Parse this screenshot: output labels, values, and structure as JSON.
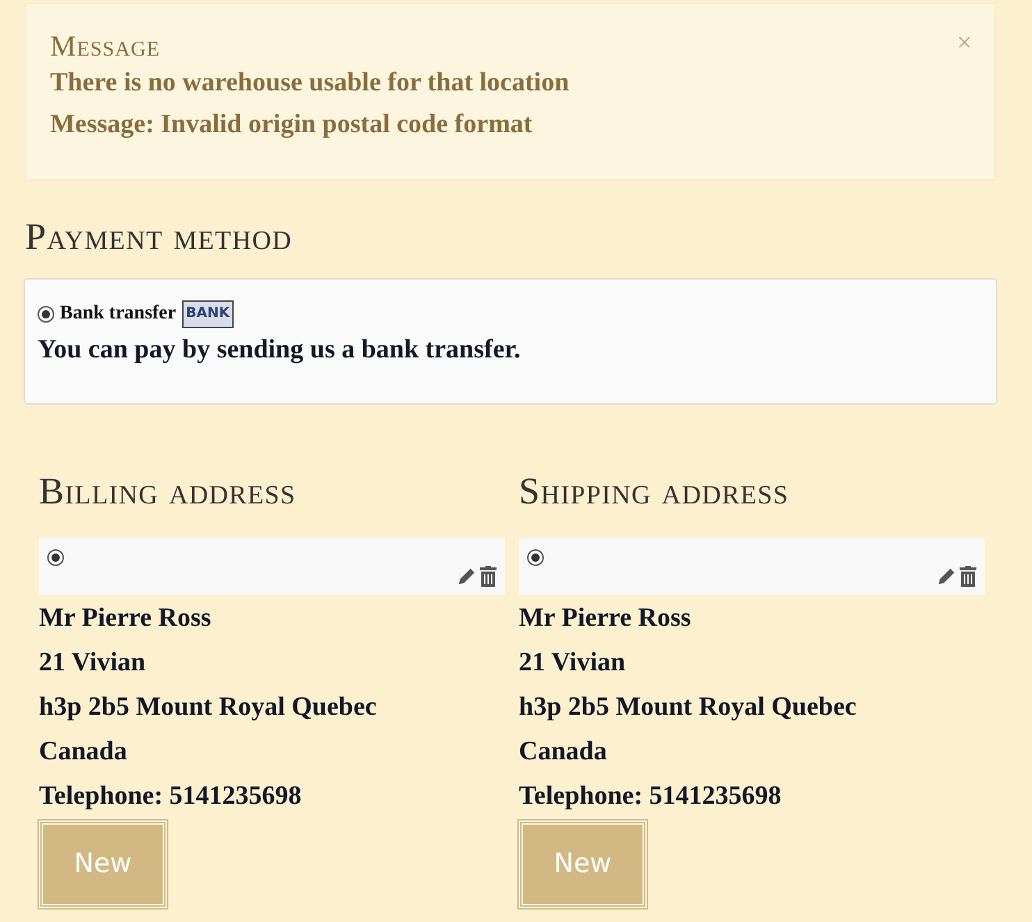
{
  "message": {
    "title": "Message",
    "close": "×",
    "lines": [
      "There is no warehouse usable for that location",
      "Message: Invalid origin postal code format"
    ]
  },
  "payment": {
    "heading": "Payment method",
    "options": [
      {
        "label": "Bank transfer",
        "logo": "BANK",
        "selected": true,
        "description": "You can pay by sending us a bank transfer."
      }
    ]
  },
  "addresses": [
    {
      "heading": "Billing address",
      "selected": true,
      "lines": [
        "Mr Pierre Ross",
        "21 Vivian",
        "h3p 2b5 Mount Royal Quebec",
        "Canada",
        "Telephone: 5141235698"
      ],
      "button": "New"
    },
    {
      "heading": "Shipping address",
      "selected": true,
      "lines": [
        "Mr Pierre Ross",
        "21 Vivian",
        "h3p 2b5 Mount Royal Quebec",
        "Canada",
        "Telephone: 5141235698"
      ],
      "button": "New"
    }
  ]
}
